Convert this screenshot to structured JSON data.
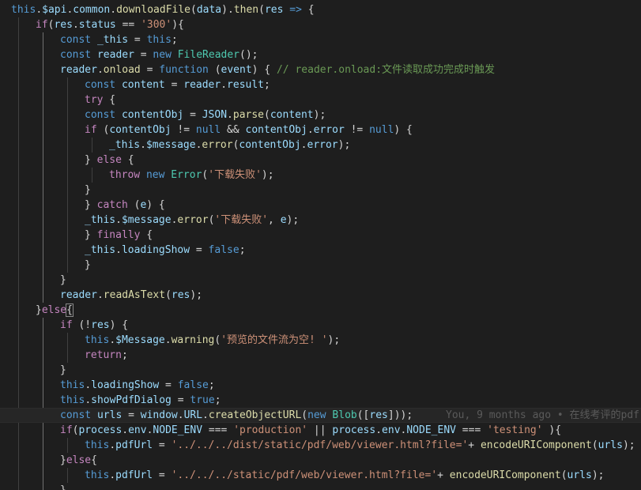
{
  "editor": {
    "blame_annotation": "You, 9 months ago • 在线考评的pdf",
    "lines": [
      {
        "indent": 0,
        "tokens": [
          [
            "k",
            "this"
          ],
          [
            "p",
            "."
          ],
          [
            "v",
            "$api"
          ],
          [
            "p",
            "."
          ],
          [
            "v",
            "common"
          ],
          [
            "p",
            "."
          ],
          [
            "f",
            "downloadFile"
          ],
          [
            "p",
            "("
          ],
          [
            "v",
            "data"
          ],
          [
            "p",
            ")."
          ],
          [
            "f",
            "then"
          ],
          [
            "p",
            "("
          ],
          [
            "v",
            "res"
          ],
          [
            "p",
            " "
          ],
          [
            "k",
            "=>"
          ],
          [
            "p",
            " {"
          ]
        ]
      },
      {
        "indent": 1,
        "tokens": [
          [
            "c",
            "if"
          ],
          [
            "p",
            "("
          ],
          [
            "v",
            "res"
          ],
          [
            "p",
            "."
          ],
          [
            "v",
            "status"
          ],
          [
            "p",
            " == "
          ],
          [
            "s",
            "'300'"
          ],
          [
            "p",
            "){"
          ]
        ]
      },
      {
        "indent": 2,
        "tokens": [
          [
            "k",
            "const"
          ],
          [
            "p",
            " "
          ],
          [
            "v",
            "_this"
          ],
          [
            "p",
            " = "
          ],
          [
            "k",
            "this"
          ],
          [
            "p",
            ";"
          ]
        ]
      },
      {
        "indent": 2,
        "tokens": [
          [
            "k",
            "const"
          ],
          [
            "p",
            " "
          ],
          [
            "v",
            "reader"
          ],
          [
            "p",
            " = "
          ],
          [
            "k",
            "new"
          ],
          [
            "p",
            " "
          ],
          [
            "t",
            "FileReader"
          ],
          [
            "p",
            "();"
          ]
        ]
      },
      {
        "indent": 2,
        "tokens": [
          [
            "v",
            "reader"
          ],
          [
            "p",
            "."
          ],
          [
            "f",
            "onload"
          ],
          [
            "p",
            " = "
          ],
          [
            "k",
            "function"
          ],
          [
            "p",
            " ("
          ],
          [
            "v",
            "event"
          ],
          [
            "p",
            ") { "
          ],
          [
            "m",
            "// reader.onload:文件读取成功完成时触发"
          ]
        ]
      },
      {
        "indent": 3,
        "tokens": [
          [
            "k",
            "const"
          ],
          [
            "p",
            " "
          ],
          [
            "v",
            "content"
          ],
          [
            "p",
            " = "
          ],
          [
            "v",
            "reader"
          ],
          [
            "p",
            "."
          ],
          [
            "v",
            "result"
          ],
          [
            "p",
            ";"
          ]
        ]
      },
      {
        "indent": 3,
        "tokens": [
          [
            "c",
            "try"
          ],
          [
            "p",
            " {"
          ]
        ]
      },
      {
        "indent": 3,
        "tokens": [
          [
            "k",
            "const"
          ],
          [
            "p",
            " "
          ],
          [
            "v",
            "contentObj"
          ],
          [
            "p",
            " = "
          ],
          [
            "v",
            "JSON"
          ],
          [
            "p",
            "."
          ],
          [
            "f",
            "parse"
          ],
          [
            "p",
            "("
          ],
          [
            "v",
            "content"
          ],
          [
            "p",
            ");"
          ]
        ]
      },
      {
        "indent": 3,
        "tokens": [
          [
            "c",
            "if"
          ],
          [
            "p",
            " ("
          ],
          [
            "v",
            "contentObj"
          ],
          [
            "p",
            " != "
          ],
          [
            "k",
            "null"
          ],
          [
            "p",
            " && "
          ],
          [
            "v",
            "contentObj"
          ],
          [
            "p",
            "."
          ],
          [
            "v",
            "error"
          ],
          [
            "p",
            " != "
          ],
          [
            "k",
            "null"
          ],
          [
            "p",
            ") {"
          ]
        ]
      },
      {
        "indent": 4,
        "tokens": [
          [
            "v",
            "_this"
          ],
          [
            "p",
            "."
          ],
          [
            "v",
            "$message"
          ],
          [
            "p",
            "."
          ],
          [
            "f",
            "error"
          ],
          [
            "p",
            "("
          ],
          [
            "v",
            "contentObj"
          ],
          [
            "p",
            "."
          ],
          [
            "v",
            "error"
          ],
          [
            "p",
            ");"
          ]
        ]
      },
      {
        "indent": 3,
        "tokens": [
          [
            "p",
            "} "
          ],
          [
            "c",
            "else"
          ],
          [
            "p",
            " {"
          ]
        ]
      },
      {
        "indent": 4,
        "tokens": [
          [
            "c",
            "throw"
          ],
          [
            "p",
            " "
          ],
          [
            "k",
            "new"
          ],
          [
            "p",
            " "
          ],
          [
            "t",
            "Error"
          ],
          [
            "p",
            "("
          ],
          [
            "s",
            "'下载失败'"
          ],
          [
            "p",
            ");"
          ]
        ]
      },
      {
        "indent": 3,
        "tokens": [
          [
            "p",
            "}"
          ]
        ]
      },
      {
        "indent": 3,
        "tokens": [
          [
            "p",
            "} "
          ],
          [
            "c",
            "catch"
          ],
          [
            "p",
            " ("
          ],
          [
            "v",
            "e"
          ],
          [
            "p",
            ") {"
          ]
        ]
      },
      {
        "indent": 3,
        "tokens": [
          [
            "v",
            "_this"
          ],
          [
            "p",
            "."
          ],
          [
            "v",
            "$message"
          ],
          [
            "p",
            "."
          ],
          [
            "f",
            "error"
          ],
          [
            "p",
            "("
          ],
          [
            "s",
            "'下载失败'"
          ],
          [
            "p",
            ", "
          ],
          [
            "v",
            "e"
          ],
          [
            "p",
            ");"
          ]
        ]
      },
      {
        "indent": 3,
        "tokens": [
          [
            "p",
            "} "
          ],
          [
            "c",
            "finally"
          ],
          [
            "p",
            " {"
          ]
        ]
      },
      {
        "indent": 3,
        "tokens": [
          [
            "v",
            "_this"
          ],
          [
            "p",
            "."
          ],
          [
            "v",
            "loadingShow"
          ],
          [
            "p",
            " = "
          ],
          [
            "k",
            "false"
          ],
          [
            "p",
            ";"
          ]
        ]
      },
      {
        "indent": 3,
        "tokens": [
          [
            "p",
            "}"
          ]
        ]
      },
      {
        "indent": 2,
        "tokens": [
          [
            "p",
            "}"
          ]
        ]
      },
      {
        "indent": 2,
        "tokens": [
          [
            "v",
            "reader"
          ],
          [
            "p",
            "."
          ],
          [
            "f",
            "readAsText"
          ],
          [
            "p",
            "("
          ],
          [
            "v",
            "res"
          ],
          [
            "p",
            ");"
          ]
        ]
      },
      {
        "indent": 1,
        "tokens": [
          [
            "p",
            "}"
          ],
          [
            "c",
            "else"
          ],
          [
            "p",
            "{"
          ]
        ]
      },
      {
        "indent": 2,
        "tokens": [
          [
            "c",
            "if"
          ],
          [
            "p",
            " (!"
          ],
          [
            "v",
            "res"
          ],
          [
            "p",
            ") {"
          ]
        ]
      },
      {
        "indent": 3,
        "tokens": [
          [
            "k",
            "this"
          ],
          [
            "p",
            "."
          ],
          [
            "v",
            "$Message"
          ],
          [
            "p",
            "."
          ],
          [
            "f",
            "warning"
          ],
          [
            "p",
            "("
          ],
          [
            "s",
            "'预览的文件流为空! '"
          ],
          [
            "p",
            ");"
          ]
        ]
      },
      {
        "indent": 3,
        "tokens": [
          [
            "c",
            "return"
          ],
          [
            "p",
            ";"
          ]
        ]
      },
      {
        "indent": 2,
        "tokens": [
          [
            "p",
            "}"
          ]
        ]
      },
      {
        "indent": 2,
        "tokens": [
          [
            "k",
            "this"
          ],
          [
            "p",
            "."
          ],
          [
            "v",
            "loadingShow"
          ],
          [
            "p",
            " = "
          ],
          [
            "k",
            "false"
          ],
          [
            "p",
            ";"
          ]
        ]
      },
      {
        "indent": 2,
        "tokens": [
          [
            "k",
            "this"
          ],
          [
            "p",
            "."
          ],
          [
            "v",
            "showPdfDialog"
          ],
          [
            "p",
            " = "
          ],
          [
            "k",
            "true"
          ],
          [
            "p",
            ";"
          ]
        ]
      },
      {
        "indent": 2,
        "tokens": [
          [
            "k",
            "const"
          ],
          [
            "p",
            " "
          ],
          [
            "v",
            "urls"
          ],
          [
            "p",
            " = "
          ],
          [
            "v",
            "window"
          ],
          [
            "p",
            "."
          ],
          [
            "v",
            "URL"
          ],
          [
            "p",
            "."
          ],
          [
            "f",
            "createObjectURL"
          ],
          [
            "p",
            "("
          ],
          [
            "k",
            "new"
          ],
          [
            "p",
            " "
          ],
          [
            "t",
            "Blob"
          ],
          [
            "p",
            "(["
          ],
          [
            "v",
            "res"
          ],
          [
            "p",
            "]));"
          ]
        ]
      },
      {
        "indent": 2,
        "tokens": [
          [
            "c",
            "if"
          ],
          [
            "p",
            "("
          ],
          [
            "v",
            "process"
          ],
          [
            "p",
            "."
          ],
          [
            "v",
            "env"
          ],
          [
            "p",
            "."
          ],
          [
            "v",
            "NODE_ENV"
          ],
          [
            "p",
            " === "
          ],
          [
            "s",
            "'production'"
          ],
          [
            "p",
            " || "
          ],
          [
            "v",
            "process"
          ],
          [
            "p",
            "."
          ],
          [
            "v",
            "env"
          ],
          [
            "p",
            "."
          ],
          [
            "v",
            "NODE_ENV"
          ],
          [
            "p",
            " === "
          ],
          [
            "s",
            "'testing'"
          ],
          [
            "p",
            " ){"
          ]
        ]
      },
      {
        "indent": 3,
        "tokens": [
          [
            "k",
            "this"
          ],
          [
            "p",
            "."
          ],
          [
            "v",
            "pdfUrl"
          ],
          [
            "p",
            " = "
          ],
          [
            "s",
            "'../../../dist/static/pdf/web/viewer.html?file='"
          ],
          [
            "p",
            "+ "
          ],
          [
            "f",
            "encodeURIComponent"
          ],
          [
            "p",
            "("
          ],
          [
            "v",
            "urls"
          ],
          [
            "p",
            ");"
          ]
        ]
      },
      {
        "indent": 2,
        "tokens": [
          [
            "p",
            "}"
          ],
          [
            "c",
            "else"
          ],
          [
            "p",
            "{"
          ]
        ]
      },
      {
        "indent": 3,
        "tokens": [
          [
            "k",
            "this"
          ],
          [
            "p",
            "."
          ],
          [
            "v",
            "pdfUrl"
          ],
          [
            "p",
            " = "
          ],
          [
            "s",
            "'../../../static/pdf/web/viewer.html?file='"
          ],
          [
            "p",
            "+ "
          ],
          [
            "f",
            "encodeURIComponent"
          ],
          [
            "p",
            "("
          ],
          [
            "v",
            "urls"
          ],
          [
            "p",
            ");"
          ]
        ]
      },
      {
        "indent": 2,
        "tokens": [
          [
            "p",
            "}"
          ]
        ]
      }
    ]
  }
}
